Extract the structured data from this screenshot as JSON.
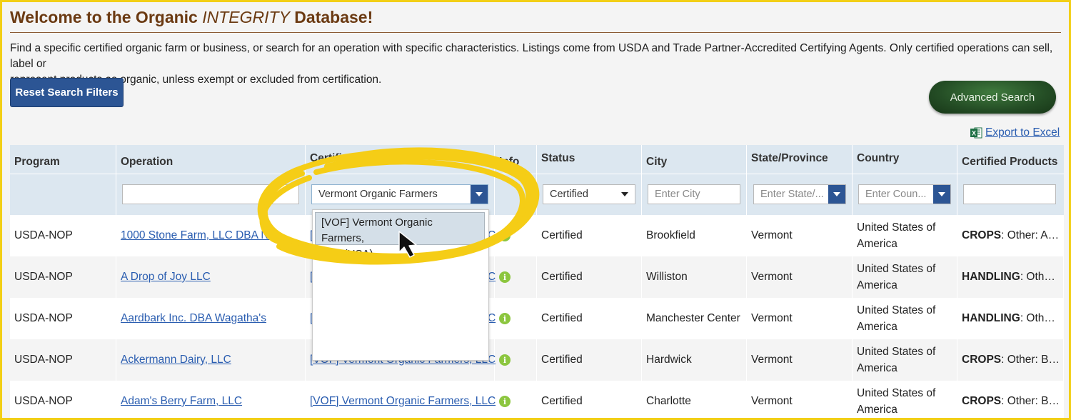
{
  "page": {
    "title_prefix": "Welcome to the Organic ",
    "title_italic": "INTEGRITY",
    "title_suffix": " Database!",
    "intro_line1": "Find a specific certified organic farm or business, or search for an operation with specific characteristics. Listings come from USDA and Trade Partner-Accredited Certifying Agents. Only certified operations can sell, label or",
    "intro_line2": "represent products as organic, unless exempt or excluded from certification."
  },
  "toolbar": {
    "reset_label": "Reset Search Filters",
    "advanced_label": "Advanced Search",
    "export_label": "Export to Excel"
  },
  "table": {
    "headers": {
      "program": "Program",
      "operation": "Operation",
      "certifier": "Certifier",
      "info": "Info",
      "status": "Status",
      "city": "City",
      "state": "State/Province",
      "country": "Country",
      "products": "Certified Products"
    },
    "filters": {
      "operation_value": "",
      "certifier_value": "Vermont Organic Farmers",
      "status_value": "Certified",
      "city_placeholder": "Enter City",
      "state_placeholder": "Enter State/...",
      "country_placeholder": "Enter Coun...",
      "products_value": ""
    },
    "suggestion": {
      "line1": "[VOF] Vermont Organic Farmers,",
      "line2": "LLC (USA)"
    },
    "rows": [
      {
        "program": "USDA-NOP",
        "operation": "1000 Stone Farm, LLC DBA N/A",
        "certifier": "[VOF] Vermont Organic Farmers, LLC",
        "status": "Certified",
        "city": "Brookfield",
        "state": "Vermont",
        "country_line1": "United States of",
        "country_line2": "America",
        "product_cat": "CROPS",
        "product_rest": ": Other: Ap..."
      },
      {
        "program": "USDA-NOP",
        "operation": "A Drop of Joy LLC",
        "certifier": "[VOF] Vermont Organic Farmers, LLC",
        "status": "Certified",
        "city": "Williston",
        "state": "Vermont",
        "country_line1": "United States of",
        "country_line2": "America",
        "product_cat": "HANDLING",
        "product_rest": ": Other..."
      },
      {
        "program": "USDA-NOP",
        "operation": "Aardbark Inc. DBA Wagatha's",
        "certifier": "[VOF] Vermont Organic Farmers, LLC",
        "status": "Certified",
        "city": "Manchester Center",
        "state": "Vermont",
        "country_line1": "United States of",
        "country_line2": "America",
        "product_cat": "HANDLING",
        "product_rest": ": Other..."
      },
      {
        "program": "USDA-NOP",
        "operation": "Ackermann Dairy, LLC",
        "certifier": "[VOF] Vermont Organic Farmers, LLC",
        "status": "Certified",
        "city": "Hardwick",
        "state": "Vermont",
        "country_line1": "United States of",
        "country_line2": "America",
        "product_cat": "CROPS",
        "product_rest": ": Other: Ba..."
      },
      {
        "program": "USDA-NOP",
        "operation": "Adam's Berry Farm, LLC",
        "certifier": "[VOF] Vermont Organic Farmers, LLC",
        "status": "Certified",
        "city": "Charlotte",
        "state": "Vermont",
        "country_line1": "United States of",
        "country_line2": "America",
        "product_cat": "CROPS",
        "product_rest": ": Other: Bl..."
      }
    ]
  },
  "colors": {
    "accent": "#2c5594",
    "title": "#6b3a12",
    "highlight": "#f2cf16",
    "link": "#2a5db0"
  }
}
